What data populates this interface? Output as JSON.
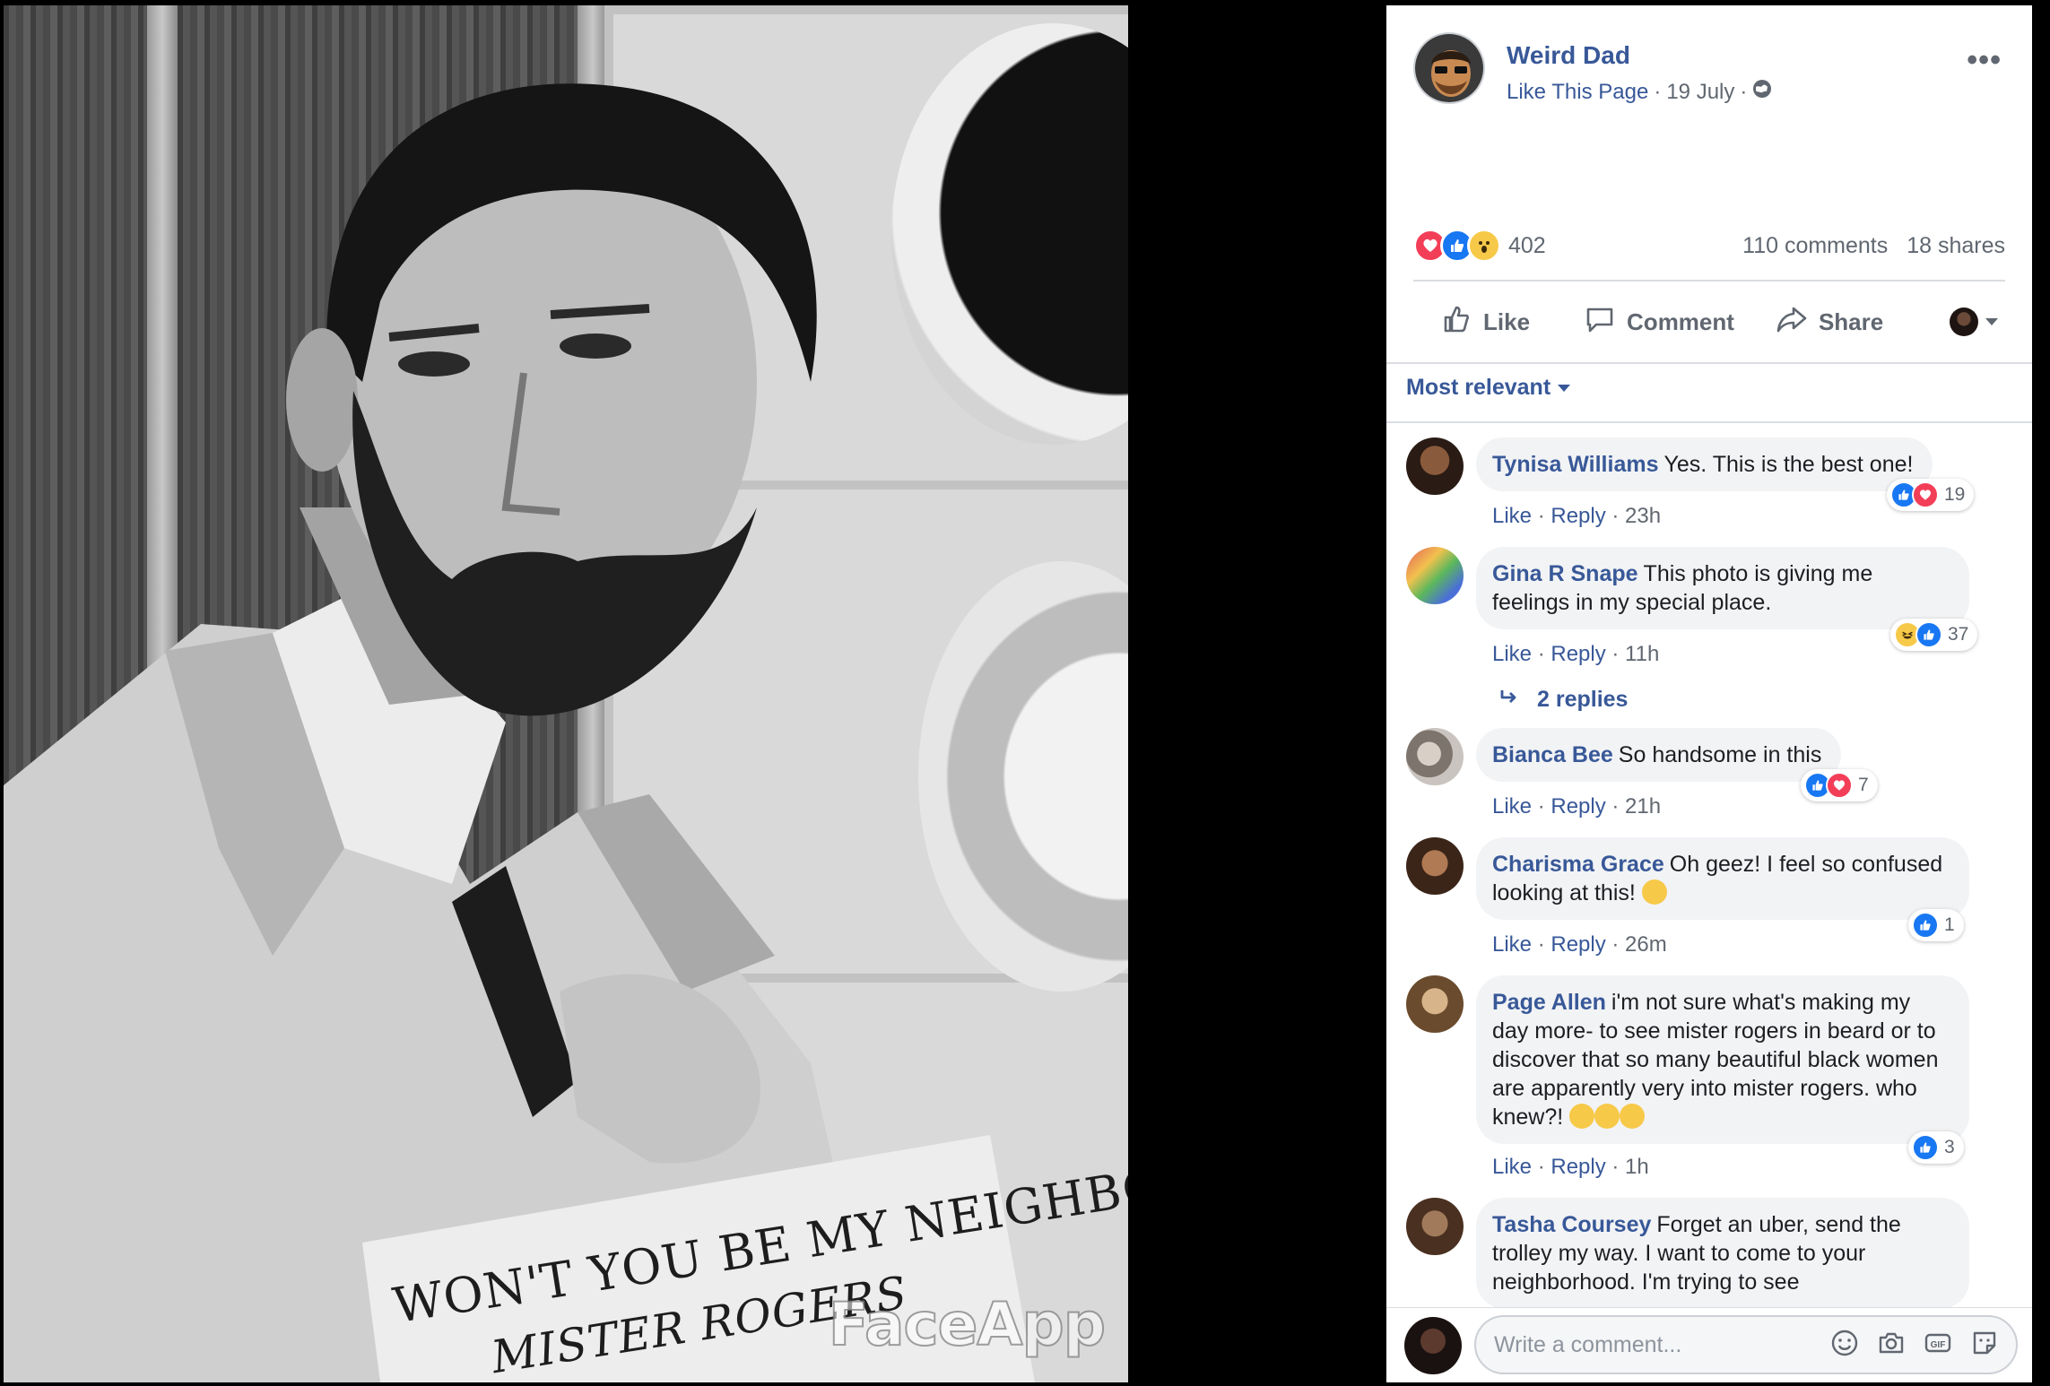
{
  "photo": {
    "sign_line1": "WON'T YOU BE MY NEIGHBOR",
    "sign_line2": "MISTER ROGERS",
    "watermark": "FaceApp"
  },
  "post": {
    "page_name": "Weird Dad",
    "like_page": "Like This Page",
    "date": "19 July",
    "reaction_count": "402",
    "comments": "110 comments",
    "shares": "18 shares",
    "reaction_icons": [
      "love-icon",
      "like-icon",
      "wow-icon"
    ]
  },
  "actions": {
    "like": "Like",
    "comment": "Comment",
    "share": "Share"
  },
  "sort_label": "Most relevant",
  "comments": [
    {
      "name": "Tynisa Williams",
      "text": "Yes. This is the best one!",
      "like": "Like",
      "reply": "Reply",
      "time": "23h",
      "reactions": [
        "like",
        "love"
      ],
      "count": "19"
    },
    {
      "name": "Gina R Snape",
      "text": "This photo is giving me feelings in my special place.",
      "like": "Like",
      "reply": "Reply",
      "time": "11h",
      "reactions": [
        "haha",
        "like"
      ],
      "count": "37"
    },
    {
      "name": "Bianca Bee",
      "text": "So handsome in this",
      "like": "Like",
      "reply": "Reply",
      "time": "21h",
      "reactions": [
        "like",
        "love"
      ],
      "count": "7"
    },
    {
      "name": "Charisma Grace",
      "text": "Oh geez! I feel so confused looking at this!",
      "like": "Like",
      "reply": "Reply",
      "time": "26m",
      "reactions": [
        "like"
      ],
      "count": "1"
    },
    {
      "name": "Page Allen",
      "text": "i'm not sure what's making my day more- to see mister rogers in beard or to discover that so many beautiful black women are apparently very into mister rogers. who knew?!",
      "like": "Like",
      "reply": "Reply",
      "time": "1h",
      "reactions": [
        "like"
      ],
      "count": "3"
    },
    {
      "name": "Tasha Coursey",
      "text": "Forget an uber, send the trolley my way. I want to come to your neighborhood. I'm trying to see"
    }
  ],
  "replies_label": "2 replies",
  "composer": {
    "placeholder": "Write a comment...",
    "tools": [
      "emoji-icon",
      "camera-icon",
      "gif-icon",
      "sticker-icon"
    ]
  },
  "colors": {
    "link_blue": "#385898",
    "like_blue": "#1877f2",
    "love_red": "#f33e58",
    "meta_grey": "#606770",
    "bubble_bg": "#f2f3f5"
  }
}
